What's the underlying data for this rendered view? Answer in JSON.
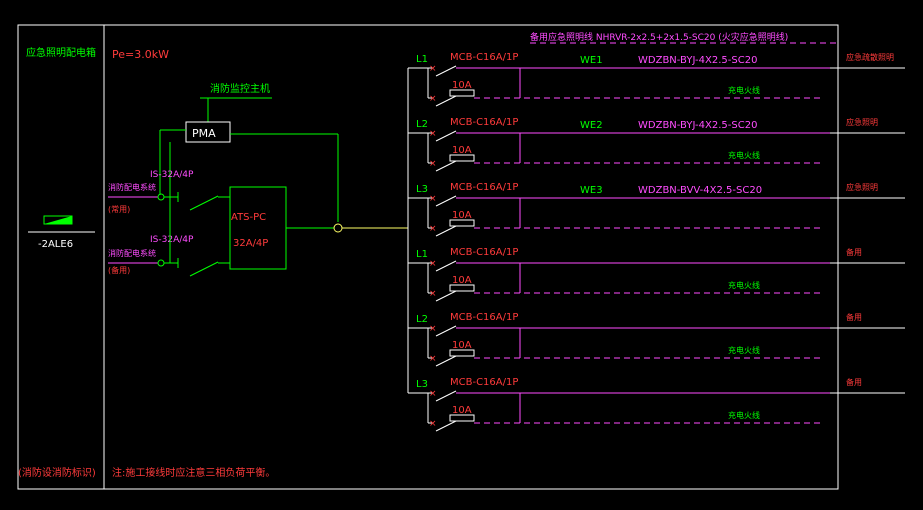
{
  "panel": {
    "title": "应急照明配电箱",
    "power": "Pe=3.0kW",
    "code": "-2ALE6",
    "note_left": "(消防设消防标识)",
    "note_bottom": "注:施工接线时应注意三相负荷平衡。"
  },
  "inputs": [
    {
      "label": "消防配电系统",
      "sub": "(常用)",
      "breaker": "IS-32A/4P"
    },
    {
      "label": "消防配电系统",
      "sub": "(备用)",
      "breaker": "IS-32A/4P"
    }
  ],
  "monitor": {
    "title": "消防监控主机",
    "pma": "PMA"
  },
  "ats": {
    "label": "ATS-PC",
    "rating": "32A/4P"
  },
  "header_cable": "备用应急照明线 NHRVR-2x2.5+2x1.5-SC20 (火灾应急照明线)",
  "circuits": [
    {
      "phase": "L1",
      "breaker": "MCB-C16A/1P",
      "fuse": "10A",
      "id": "WE1",
      "cable": "WDZBN-BYJ-4X2.5-SC20",
      "charge": "充电火线",
      "load": "应急疏散照明"
    },
    {
      "phase": "L2",
      "breaker": "MCB-C16A/1P",
      "fuse": "10A",
      "id": "WE2",
      "cable": "WDZBN-BYJ-4X2.5-SC20",
      "charge": "充电火线",
      "load": "应急照明"
    },
    {
      "phase": "L3",
      "breaker": "MCB-C16A/1P",
      "fuse": "10A",
      "id": "WE3",
      "cable": "WDZBN-BVV-4X2.5-SC20",
      "charge": "",
      "load": "应急照明"
    },
    {
      "phase": "L1",
      "breaker": "MCB-C16A/1P",
      "fuse": "10A",
      "id": "",
      "cable": "",
      "charge": "充电火线",
      "load": "备用"
    },
    {
      "phase": "L2",
      "breaker": "MCB-C16A/1P",
      "fuse": "10A",
      "id": "",
      "cable": "",
      "charge": "充电火线",
      "load": "备用"
    },
    {
      "phase": "L3",
      "breaker": "MCB-C16A/1P",
      "fuse": "10A",
      "id": "",
      "cable": "",
      "charge": "充电火线",
      "load": "备用"
    }
  ],
  "colors": {
    "frame": "#ffffff",
    "wire": "#00ff00",
    "label": "#ff3b3b",
    "circuit": "#ff4dff",
    "bus": "#ffff66"
  }
}
